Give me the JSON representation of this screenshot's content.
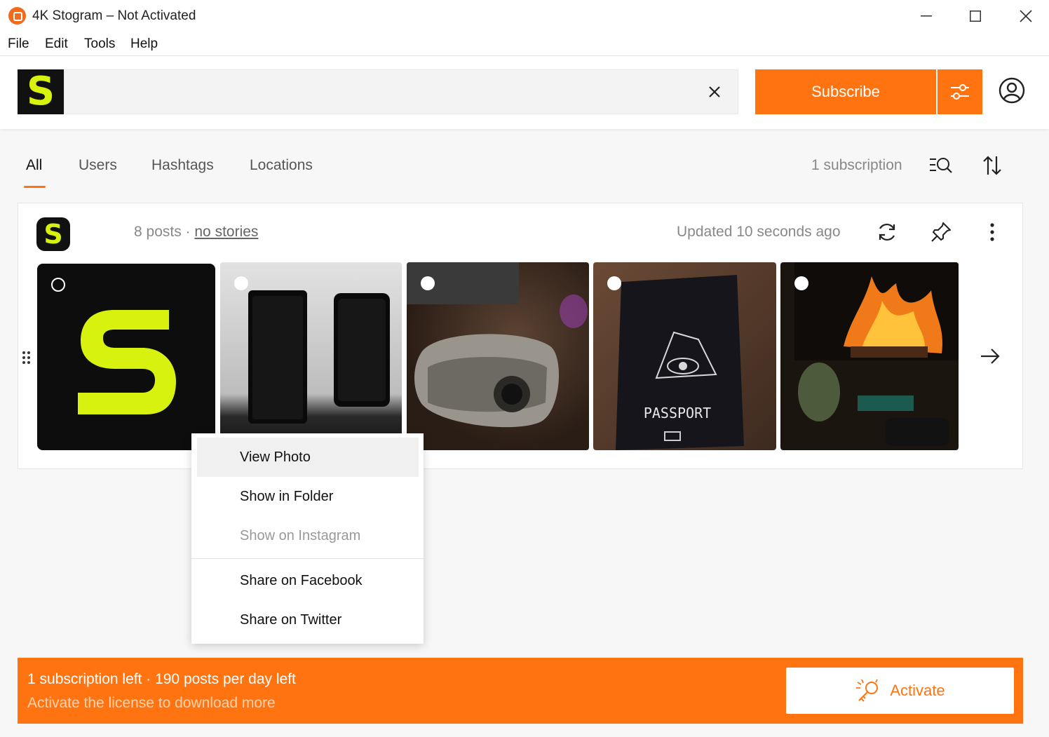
{
  "window": {
    "title": "4K Stogram – Not Activated",
    "minimize_icon": "minimize-icon",
    "maximize_icon": "maximize-icon",
    "close_icon": "close-icon"
  },
  "menu": {
    "items": [
      "File",
      "Edit",
      "Tools",
      "Help"
    ]
  },
  "toolbar": {
    "logo_letter": "S",
    "search_value": "",
    "search_placeholder": "",
    "subscribe_label": "Subscribe",
    "accent": "#ff7410"
  },
  "tabs": [
    {
      "label": "All",
      "active": true
    },
    {
      "label": "Users",
      "active": false
    },
    {
      "label": "Hashtags",
      "active": false
    },
    {
      "label": "Locations",
      "active": false
    }
  ],
  "subscriptions": {
    "count_label": "1 subscription"
  },
  "card": {
    "logo_letter": "S",
    "posts_text": "8 posts · ",
    "stories_link": "no stories",
    "updated_text": "Updated 10 seconds ago",
    "thumbnails": [
      {
        "subject": "stogram-logo"
      },
      {
        "subject": "two-phones"
      },
      {
        "subject": "dxo-camera"
      },
      {
        "subject": "nvidia-passport"
      },
      {
        "subject": "fireplace"
      }
    ]
  },
  "context_menu": {
    "items": [
      {
        "label": "View Photo",
        "state": "hover"
      },
      {
        "label": "Show in Folder",
        "state": "normal"
      },
      {
        "label": "Show on Instagram",
        "state": "disabled"
      },
      {
        "label": "Share on Facebook",
        "state": "normal"
      },
      {
        "label": "Share on Twitter",
        "state": "normal"
      }
    ]
  },
  "banner": {
    "line1": "1 subscription left · 190 posts per day left",
    "line2": "Activate the license to download more",
    "activate_label": "Activate"
  }
}
